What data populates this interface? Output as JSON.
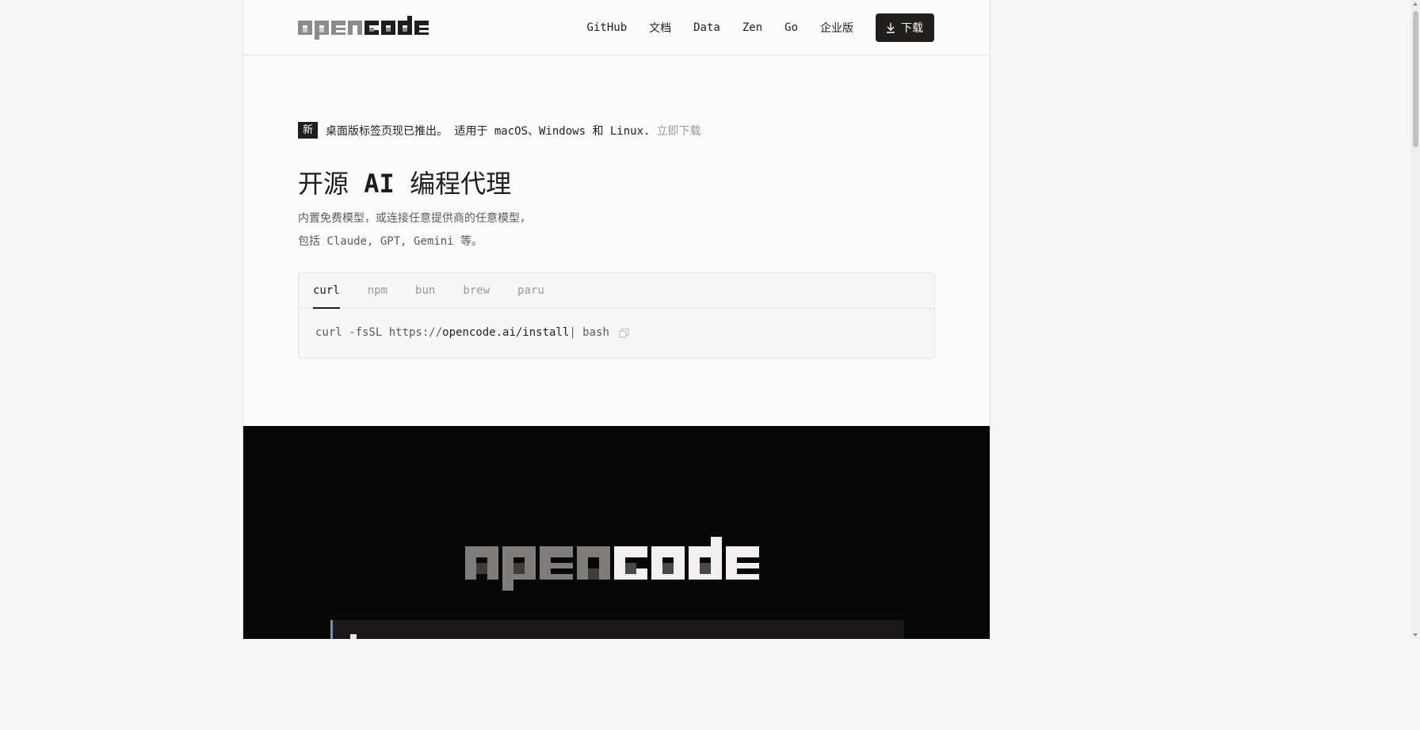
{
  "brand": {
    "logo_text": "opencode"
  },
  "nav": {
    "items": [
      {
        "label": "GitHub"
      },
      {
        "label": "文档"
      },
      {
        "label": "Data"
      },
      {
        "label": "Zen"
      },
      {
        "label": "Go"
      },
      {
        "label": "企业版"
      }
    ],
    "download_label": "下载"
  },
  "announcement": {
    "badge": "新",
    "text": "桌面版标签页现已推出。 适用于 macOS、Windows 和 Linux.",
    "link": "立即下载"
  },
  "hero": {
    "title_pre": "开源 ",
    "title_bold": "AI",
    "title_post": " 编程代理",
    "subtitle_line1": "内置免费模型，或连接任意提供商的任意模型，",
    "subtitle_line2": "包括 Claude, GPT, Gemini 等。"
  },
  "install": {
    "tabs": [
      {
        "label": "curl",
        "active": true
      },
      {
        "label": "npm"
      },
      {
        "label": "bun"
      },
      {
        "label": "brew"
      },
      {
        "label": "paru"
      }
    ],
    "command_pre": "curl -fsSL https://",
    "command_strong": "opencode.ai/install",
    "command_post": " | bash"
  },
  "colors": {
    "text": "#201d1d",
    "muted": "#9a9898",
    "dark_bg": "#080707",
    "accent_border": "#6b8fd4"
  },
  "icons": {
    "download": "download-icon",
    "copy": "copy-icon"
  }
}
